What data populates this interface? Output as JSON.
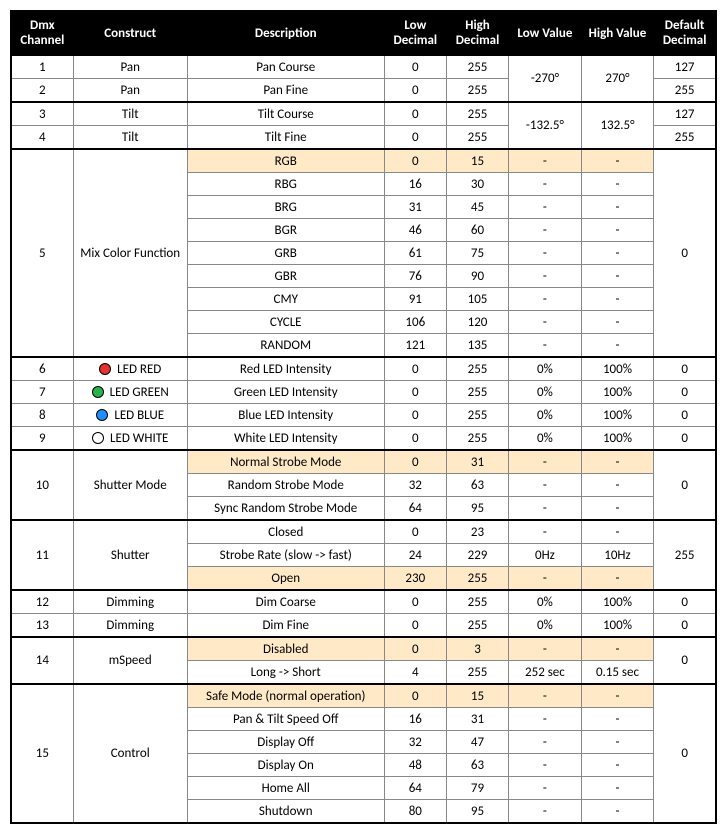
{
  "headers": {
    "dmx": "Dmx Channel",
    "construct": "Construct",
    "desc": "Description",
    "lowDec": "Low Decimal",
    "highDec": "High Decimal",
    "lowVal": "Low Value",
    "highVal": "High Value",
    "defDec": "Default Decimal"
  },
  "rows": {
    "r1": {
      "ch": "1",
      "construct": "Pan",
      "desc": "Pan Course",
      "ld": "0",
      "hd": "255",
      "def": "127"
    },
    "r2": {
      "ch": "2",
      "construct": "Pan",
      "desc": "Pan Fine",
      "ld": "0",
      "hd": "255",
      "def": "255"
    },
    "panLow": "-270°",
    "panHigh": "270°",
    "r3": {
      "ch": "3",
      "construct": "Tilt",
      "desc": "Tilt Course",
      "ld": "0",
      "hd": "255",
      "def": "127"
    },
    "r4": {
      "ch": "4",
      "construct": "Tilt",
      "desc": "Tilt Fine",
      "ld": "0",
      "hd": "255",
      "def": "255"
    },
    "tiltLow": "-132.5°",
    "tiltHigh": "132.5°",
    "ch5": "5",
    "ch5Construct": "Mix Color Function",
    "ch5Def": "0",
    "r5a": {
      "desc": "RGB",
      "ld": "0",
      "hd": "15",
      "lv": "-",
      "hv": "-"
    },
    "r5b": {
      "desc": "RBG",
      "ld": "16",
      "hd": "30",
      "lv": "-",
      "hv": "-"
    },
    "r5c": {
      "desc": "BRG",
      "ld": "31",
      "hd": "45",
      "lv": "-",
      "hv": "-"
    },
    "r5d": {
      "desc": "BGR",
      "ld": "46",
      "hd": "60",
      "lv": "-",
      "hv": "-"
    },
    "r5e": {
      "desc": "GRB",
      "ld": "61",
      "hd": "75",
      "lv": "-",
      "hv": "-"
    },
    "r5f": {
      "desc": "GBR",
      "ld": "76",
      "hd": "90",
      "lv": "-",
      "hv": "-"
    },
    "r5g": {
      "desc": "CMY",
      "ld": "91",
      "hd": "105",
      "lv": "-",
      "hv": "-"
    },
    "r5h": {
      "desc": "CYCLE",
      "ld": "106",
      "hd": "120",
      "lv": "-",
      "hv": "-"
    },
    "r5i": {
      "desc": "RANDOM",
      "ld": "121",
      "hd": "135",
      "lv": "-",
      "hv": "-"
    },
    "r6": {
      "ch": "6",
      "construct": "LED RED",
      "desc": "Red LED Intensity",
      "ld": "0",
      "hd": "255",
      "lv": "0%",
      "hv": "100%",
      "def": "0"
    },
    "r7": {
      "ch": "7",
      "construct": "LED GREEN",
      "desc": "Green LED Intensity",
      "ld": "0",
      "hd": "255",
      "lv": "0%",
      "hv": "100%",
      "def": "0"
    },
    "r8": {
      "ch": "8",
      "construct": "LED BLUE",
      "desc": "Blue LED Intensity",
      "ld": "0",
      "hd": "255",
      "lv": "0%",
      "hv": "100%",
      "def": "0"
    },
    "r9": {
      "ch": "9",
      "construct": "LED WHITE",
      "desc": "White LED Intensity",
      "ld": "0",
      "hd": "255",
      "lv": "0%",
      "hv": "100%",
      "def": "0"
    },
    "ch10": "10",
    "ch10Construct": "Shutter Mode",
    "ch10Def": "0",
    "r10a": {
      "desc": "Normal Strobe Mode",
      "ld": "0",
      "hd": "31",
      "lv": "-",
      "hv": "-"
    },
    "r10b": {
      "desc": "Random Strobe Mode",
      "ld": "32",
      "hd": "63",
      "lv": "-",
      "hv": "-"
    },
    "r10c": {
      "desc": "Sync Random Strobe Mode",
      "ld": "64",
      "hd": "95",
      "lv": "-",
      "hv": "-"
    },
    "ch11": "11",
    "ch11Construct": "Shutter",
    "ch11Def": "255",
    "r11a": {
      "desc": "Closed",
      "ld": "0",
      "hd": "23",
      "lv": "-",
      "hv": "-"
    },
    "r11b": {
      "desc": "Strobe Rate (slow -> fast)",
      "ld": "24",
      "hd": "229",
      "lv": "0Hz",
      "hv": "10Hz"
    },
    "r11c": {
      "desc": "Open",
      "ld": "230",
      "hd": "255",
      "lv": "-",
      "hv": "-"
    },
    "r12": {
      "ch": "12",
      "construct": "Dimming",
      "desc": "Dim Coarse",
      "ld": "0",
      "hd": "255",
      "lv": "0%",
      "hv": "100%",
      "def": "0"
    },
    "r13": {
      "ch": "13",
      "construct": "Dimming",
      "desc": "Dim Fine",
      "ld": "0",
      "hd": "255",
      "lv": "0%",
      "hv": "100%",
      "def": "0"
    },
    "ch14": "14",
    "ch14Construct": "mSpeed",
    "ch14Def": "0",
    "r14a": {
      "desc": "Disabled",
      "ld": "0",
      "hd": "3",
      "lv": "-",
      "hv": "-"
    },
    "r14b": {
      "desc": "Long -> Short",
      "ld": "4",
      "hd": "255",
      "lv": "252 sec",
      "hv": "0.15 sec"
    },
    "ch15": "15",
    "ch15Construct": "Control",
    "ch15Def": "0",
    "r15a": {
      "desc": "Safe Mode (normal operation)",
      "ld": "0",
      "hd": "15",
      "lv": "-",
      "hv": "-"
    },
    "r15b": {
      "desc": "Pan & Tilt Speed Off",
      "ld": "16",
      "hd": "31",
      "lv": "-",
      "hv": "-"
    },
    "r15c": {
      "desc": "Display Off",
      "ld": "32",
      "hd": "47",
      "lv": "-",
      "hv": "-"
    },
    "r15d": {
      "desc": "Display On",
      "ld": "48",
      "hd": "63",
      "lv": "-",
      "hv": "-"
    },
    "r15e": {
      "desc": "Home All",
      "ld": "64",
      "hd": "79",
      "lv": "-",
      "hv": "-"
    },
    "r15f": {
      "desc": "Shutdown",
      "ld": "80",
      "hd": "95",
      "lv": "-",
      "hv": "-"
    }
  }
}
